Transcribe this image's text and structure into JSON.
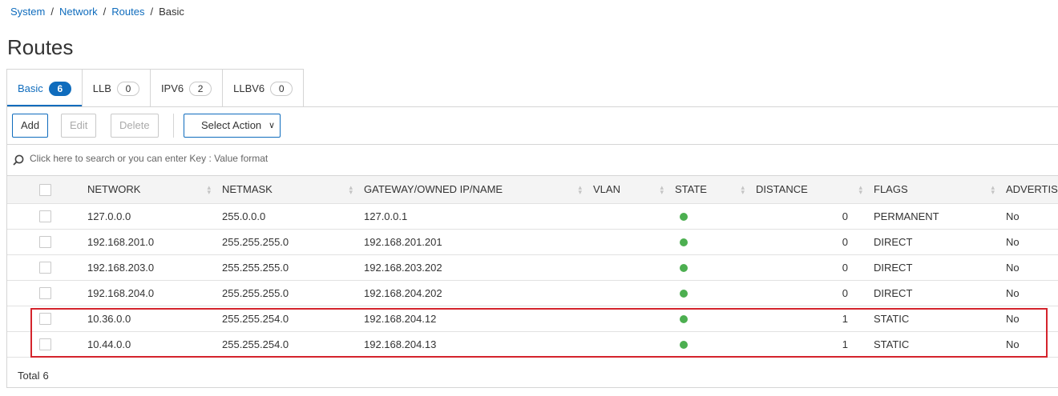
{
  "breadcrumb": [
    "System",
    "Network",
    "Routes",
    "Basic"
  ],
  "page_title": "Routes",
  "tabs": [
    {
      "label": "Basic",
      "count": "6"
    },
    {
      "label": "LLB",
      "count": "0"
    },
    {
      "label": "IPV6",
      "count": "2"
    },
    {
      "label": "LLBV6",
      "count": "0"
    }
  ],
  "toolbar": {
    "add_label": "Add",
    "edit_label": "Edit",
    "delete_label": "Delete",
    "select_action_label": "Select Action"
  },
  "search": {
    "placeholder": "Click here to search or you can enter Key : Value format"
  },
  "table": {
    "columns": [
      "NETWORK",
      "NETMASK",
      "GATEWAY/OWNED IP/NAME",
      "VLAN",
      "STATE",
      "DISTANCE",
      "FLAGS",
      "ADVERTISE"
    ],
    "rows": [
      {
        "network": "127.0.0.0",
        "netmask": "255.0.0.0",
        "gateway": "127.0.0.1",
        "vlan": "",
        "state": "up",
        "distance": "0",
        "flags": "PERMANENT",
        "advertise": "No"
      },
      {
        "network": "192.168.201.0",
        "netmask": "255.255.255.0",
        "gateway": "192.168.201.201",
        "vlan": "",
        "state": "up",
        "distance": "0",
        "flags": "DIRECT",
        "advertise": "No"
      },
      {
        "network": "192.168.203.0",
        "netmask": "255.255.255.0",
        "gateway": "192.168.203.202",
        "vlan": "",
        "state": "up",
        "distance": "0",
        "flags": "DIRECT",
        "advertise": "No"
      },
      {
        "network": "192.168.204.0",
        "netmask": "255.255.255.0",
        "gateway": "192.168.204.202",
        "vlan": "",
        "state": "up",
        "distance": "0",
        "flags": "DIRECT",
        "advertise": "No"
      },
      {
        "network": "10.36.0.0",
        "netmask": "255.255.254.0",
        "gateway": "192.168.204.12",
        "vlan": "",
        "state": "up",
        "distance": "1",
        "flags": "STATIC",
        "advertise": "No"
      },
      {
        "network": "10.44.0.0",
        "netmask": "255.255.254.0",
        "gateway": "192.168.204.13",
        "vlan": "",
        "state": "up",
        "distance": "1",
        "flags": "STATIC",
        "advertise": "No"
      }
    ]
  },
  "footer": {
    "total_label": "Total",
    "total_value": "6"
  },
  "colors": {
    "accent": "#0f6cbd",
    "state_up": "#4caf50",
    "highlight": "#d4242c"
  }
}
